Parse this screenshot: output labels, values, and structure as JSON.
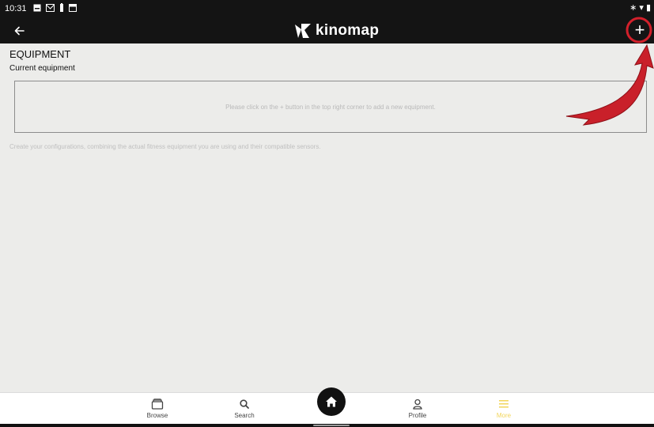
{
  "status_bar": {
    "time": "10:31",
    "left_icons": [
      "notification-image-icon",
      "mail-icon",
      "battery-small-icon",
      "calendar-icon"
    ],
    "right_icons": [
      "bluetooth-icon",
      "wifi-icon",
      "battery-icon"
    ]
  },
  "app_bar": {
    "brand": "kinomap",
    "back_icon": "arrow-left-icon",
    "add_icon": "plus-icon",
    "add_symbol": "+"
  },
  "page": {
    "title": "EQUIPMENT",
    "section": "Current equipment",
    "empty_message": "Please click on the + button in the top right corner to add a new equipment.",
    "hint": "Create your configurations, combining the actual fitness equipment you are using and their compatible sensors."
  },
  "bottom_nav": {
    "items": [
      {
        "label": "Browse",
        "icon": "folder-icon"
      },
      {
        "label": "Search",
        "icon": "search-icon"
      },
      {
        "label": "Profile",
        "icon": "person-icon"
      },
      {
        "label": "More",
        "icon": "menu-icon"
      }
    ],
    "home_icon": "home-icon"
  },
  "colors": {
    "app_bar_bg": "#141414",
    "page_bg": "#ececea",
    "accent_active": "#f2d55b",
    "annotation_red": "#d3202b"
  }
}
